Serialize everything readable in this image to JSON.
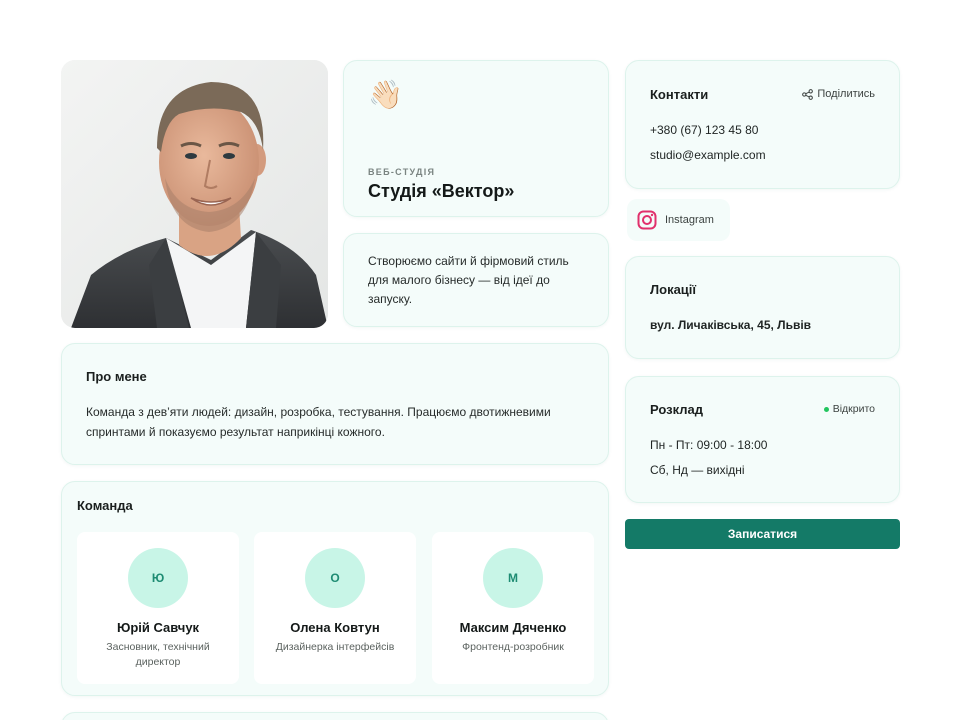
{
  "hero": {
    "wave_emoji": "👋🏻",
    "eyebrow": "ВЕБ-СТУДІЯ",
    "studio_name": "Студія «Вектор»",
    "tagline": "Створюємо сайти й фірмовий стиль для малого бізнесу — від ідеї до запуску."
  },
  "about": {
    "title": "Про мене",
    "text": "Команда з дев’яти людей: дизайн, розробка, тестування. Працюємо двотижневими спринтами й показуємо результат наприкінці кожного."
  },
  "team": {
    "title": "Команда",
    "members": [
      {
        "initial": "Ю",
        "name": "Юрій Савчук",
        "role": "Засновник, технічний директор"
      },
      {
        "initial": "О",
        "name": "Олена Ковтун",
        "role": "Дизайнерка інтерфейсів"
      },
      {
        "initial": "М",
        "name": "Максим Дяченко",
        "role": "Фронтенд-розробник"
      }
    ]
  },
  "contacts": {
    "title": "Контакти",
    "share_label": "Поділитись",
    "phone": "+380 (67) 123 45 80",
    "email": "studio@example.com"
  },
  "social": {
    "instagram_label": "Instagram"
  },
  "location": {
    "title": "Локації",
    "address": "вул. Личаківська, 45, Львів"
  },
  "schedule": {
    "title": "Розклад",
    "status": "Відкрито",
    "weekdays": "Пн - Пт: 09:00 - 18:00",
    "weekend": "Сб, Нд — вихідні"
  },
  "cta": {
    "label": "Записатися"
  },
  "colors": {
    "accent": "#147a67",
    "card_bg": "#f4fcfa",
    "avatar_bg": "#c8f5e7",
    "status_green": "#22c55e",
    "instagram": "#e1306c"
  }
}
